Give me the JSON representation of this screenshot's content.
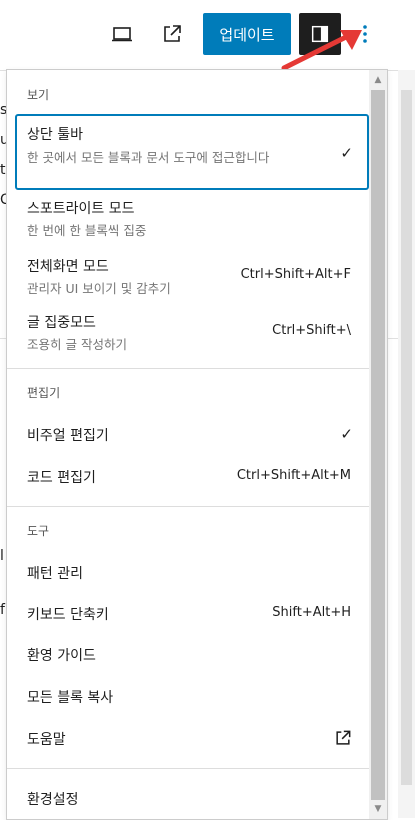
{
  "toolbar": {
    "update_label": "업데이트",
    "icons": [
      "desktop-preview-icon",
      "external-link-icon",
      "settings-sidebar-icon",
      "more-options-icon"
    ]
  },
  "colors": {
    "accent": "#007cba",
    "dark": "#1e1e1e",
    "arrow": "#e53935"
  },
  "background_fragments": [
    "se",
    "u",
    "ti",
    "C",
    "l",
    "f"
  ],
  "menu": {
    "view": {
      "label": "보기",
      "items": [
        {
          "label": "상단 툴바",
          "desc": "한 곳에서 모든 블록과 문서 도구에 접근합니다",
          "checked": true
        },
        {
          "label": "스포트라이트 모드",
          "desc": "한 번에 한 블록씩 집중"
        },
        {
          "label": "전체화면 모드",
          "desc": "관리자 UI 보이기 및 감추기",
          "shortcut": "Ctrl+Shift+Alt+F"
        },
        {
          "label": "글 집중모드",
          "desc": "조용히 글 작성하기",
          "shortcut": "Ctrl+Shift+\\"
        }
      ]
    },
    "editor": {
      "label": "편집기",
      "items": [
        {
          "label": "비주얼 편집기",
          "checked": true
        },
        {
          "label": "코드 편집기",
          "shortcut": "Ctrl+Shift+Alt+M"
        }
      ]
    },
    "tools": {
      "label": "도구",
      "items": [
        {
          "label": "패턴 관리"
        },
        {
          "label": "키보드 단축키",
          "shortcut": "Shift+Alt+H"
        },
        {
          "label": "환영 가이드"
        },
        {
          "label": "모든 블록 복사"
        },
        {
          "label": "도움말"
        }
      ]
    },
    "preferences_label": "환경설정"
  }
}
